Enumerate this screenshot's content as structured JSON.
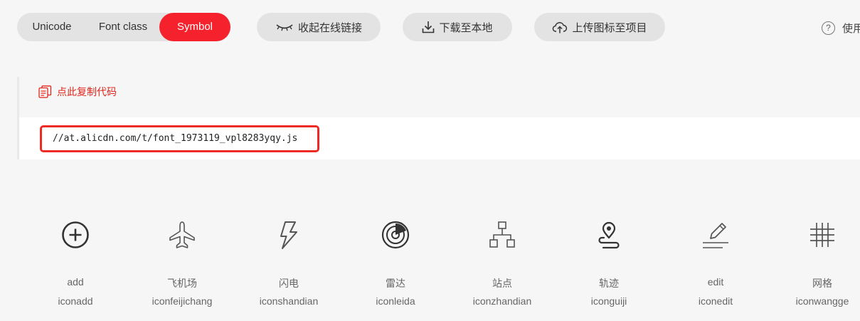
{
  "tabs": {
    "unicode": "Unicode",
    "font_class": "Font class",
    "symbol": "Symbol"
  },
  "toolbar": {
    "collapse_label": "收起在线链接",
    "download_label": "下载至本地",
    "upload_label": "上传图标至项目",
    "help_label": "使用帮助"
  },
  "code_panel": {
    "copy_label": "点此复制代码",
    "code": "//at.alicdn.com/t/font_1973119_vpl8283yqy.js"
  },
  "icons": [
    {
      "name": "add",
      "code": "iconadd",
      "icon": "add-icon"
    },
    {
      "name": "飞机场",
      "code": "iconfeijichang",
      "icon": "airport-icon"
    },
    {
      "name": "闪电",
      "code": "iconshandian",
      "icon": "lightning-icon"
    },
    {
      "name": "雷达",
      "code": "iconleida",
      "icon": "radar-icon"
    },
    {
      "name": "站点",
      "code": "iconzhandian",
      "icon": "site-icon"
    },
    {
      "name": "轨迹",
      "code": "iconguiji",
      "icon": "track-icon"
    },
    {
      "name": "edit",
      "code": "iconedit",
      "icon": "edit-icon"
    },
    {
      "name": "网格",
      "code": "iconwangge",
      "icon": "grid-icon"
    }
  ],
  "colors": {
    "accent": "#f5222d",
    "link": "#e1251b",
    "highlight_border": "#ee2a24"
  }
}
